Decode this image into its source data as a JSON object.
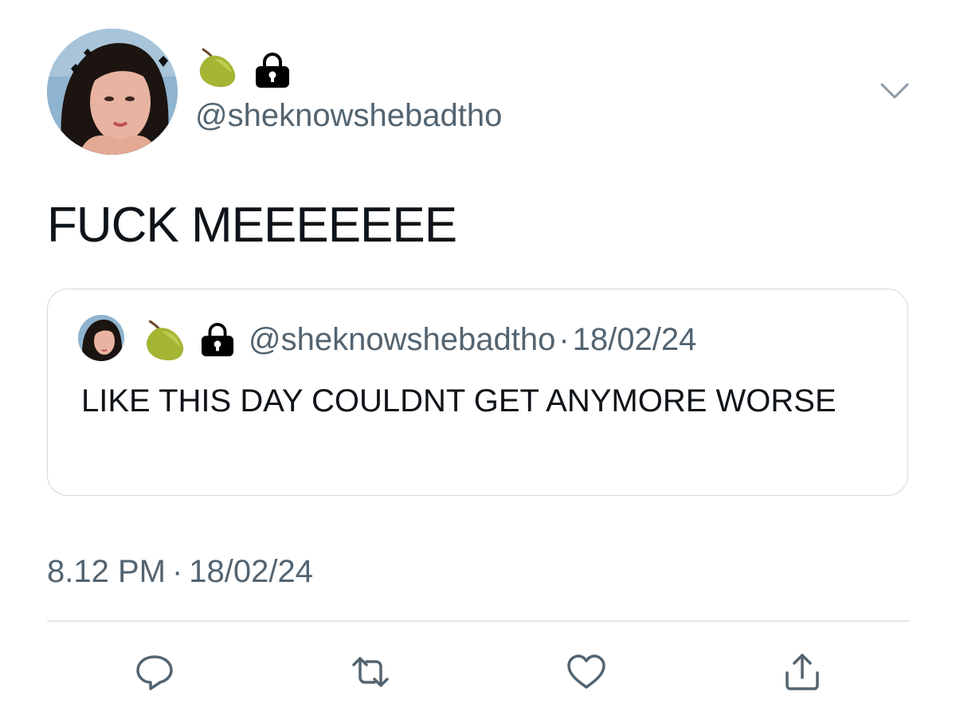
{
  "tweet": {
    "author": {
      "handle": "@sheknowshebadtho",
      "name_emoji": [
        "pear-icon",
        "lock-icon"
      ]
    },
    "text": "FUCK MEEEEEEE",
    "timestamp": {
      "time": "8.12 PM",
      "separator": "·",
      "date": "18/02/24"
    }
  },
  "quoted_tweet": {
    "handle": "@sheknowshebadtho",
    "separator": "·",
    "date": "18/02/24",
    "text": "LIKE THIS DAY COULDNT GET ANYMORE WORSE"
  },
  "actions": [
    "reply-icon",
    "retweet-icon",
    "like-icon",
    "share-icon"
  ],
  "colors": {
    "text_primary": "#0f1419",
    "text_secondary": "#536471",
    "border": "#cfd9de",
    "divider": "#e1e8ed",
    "icon": "#536471"
  }
}
